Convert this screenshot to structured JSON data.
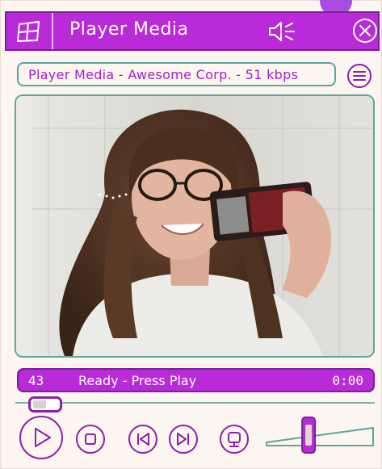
{
  "window": {
    "title": "Player Media",
    "now_playing": "Player Media - Awesome Corp. - 51 kbps"
  },
  "status": {
    "track_number": "43",
    "message": "Ready - Press Play",
    "time": "0:00"
  },
  "seek": {
    "position": 0.04
  },
  "volume": {
    "level": 0.38
  },
  "controls": {
    "play": "play-icon",
    "stop": "stop-icon",
    "previous": "skip-back-icon",
    "next": "skip-forward-icon",
    "visualizer": "monitor-icon",
    "menu": "menu-icon",
    "mute": "speaker-icon",
    "close": "close-icon"
  },
  "colors": {
    "accent": "#b92bd8",
    "accent_dark": "#7b1f9a",
    "outline": "#5aa89a",
    "background": "#fdf5f0"
  }
}
